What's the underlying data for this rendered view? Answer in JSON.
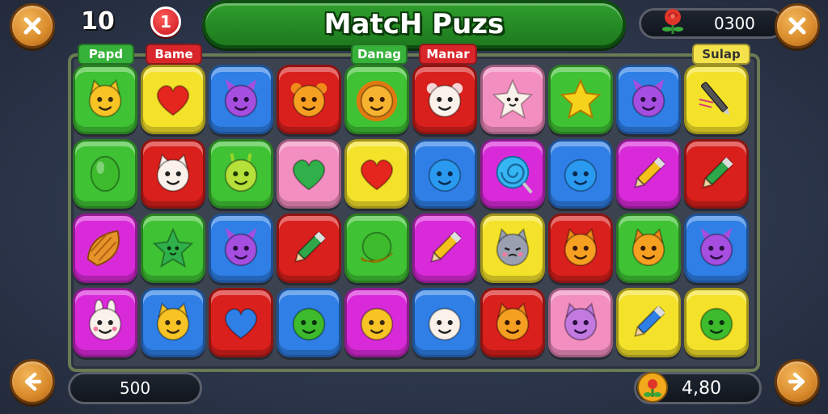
{
  "header": {
    "moves": "10",
    "badge_count": "1",
    "title": "MatcH Puzs",
    "score": "0300"
  },
  "tags": [
    {
      "label": "Papd",
      "color": "green"
    },
    {
      "label": "Bame",
      "color": "red"
    },
    {
      "label": "Danag",
      "color": "green"
    },
    {
      "label": "Manar",
      "color": "red"
    },
    {
      "label": "Sulap",
      "color": "yellow"
    }
  ],
  "footer": {
    "left_value": "500",
    "right_value": "4,80"
  },
  "icons": {
    "top_left": "close-icon",
    "top_right": "close-icon",
    "bottom_left": "arrow-left-icon",
    "bottom_right": "arrow-right-icon",
    "score": "rose-icon",
    "footer_right": "flower-coin-icon"
  },
  "colors": {
    "green": "#3fc234",
    "yellow": "#f4e22a",
    "blue": "#2f7fe6",
    "red": "#d9201c",
    "pink": "#f38ec0",
    "magenta": "#d92ad9",
    "title_green": "#2f9e2c",
    "button_orange": "#d8892a"
  },
  "tiles": [
    [
      {
        "bg": "green",
        "icon": "yellow-cat-face-icon"
      },
      {
        "bg": "yellow",
        "icon": "red-heart-icon"
      },
      {
        "bg": "blue",
        "icon": "purple-monster-face-icon"
      },
      {
        "bg": "red",
        "icon": "orange-bear-face-icon"
      },
      {
        "bg": "green",
        "icon": "orange-lion-face-icon"
      },
      {
        "bg": "red",
        "icon": "white-hamster-face-icon"
      },
      {
        "bg": "pink",
        "icon": "white-star-face-icon"
      },
      {
        "bg": "green",
        "icon": "yellow-star-icon"
      },
      {
        "bg": "blue",
        "icon": "purple-monster-face-icon"
      },
      {
        "bg": "yellow",
        "icon": "pen-icon"
      }
    ],
    [
      {
        "bg": "green",
        "icon": "green-egg-icon"
      },
      {
        "bg": "red",
        "icon": "white-cat-face-icon"
      },
      {
        "bg": "green",
        "icon": "lime-alien-face-icon"
      },
      {
        "bg": "pink",
        "icon": "green-heart-icon"
      },
      {
        "bg": "yellow",
        "icon": "red-heart-icon"
      },
      {
        "bg": "blue",
        "icon": "blue-blob-face-icon"
      },
      {
        "bg": "magenta",
        "icon": "blue-lollipop-icon"
      },
      {
        "bg": "blue",
        "icon": "blue-blob-face-icon"
      },
      {
        "bg": "magenta",
        "icon": "yellow-pencil-icon"
      },
      {
        "bg": "red",
        "icon": "green-marker-icon"
      }
    ],
    [
      {
        "bg": "magenta",
        "icon": "orange-croissant-icon"
      },
      {
        "bg": "green",
        "icon": "green-star-face-icon"
      },
      {
        "bg": "blue",
        "icon": "purple-monster-face-icon"
      },
      {
        "bg": "red",
        "icon": "green-marker-icon"
      },
      {
        "bg": "green",
        "icon": "green-ball-icon"
      },
      {
        "bg": "magenta",
        "icon": "yellow-pencil-icon"
      },
      {
        "bg": "yellow",
        "icon": "grey-cat-face-icon"
      },
      {
        "bg": "red",
        "icon": "orange-fox-face-icon"
      },
      {
        "bg": "green",
        "icon": "orange-fox-face-icon"
      },
      {
        "bg": "blue",
        "icon": "purple-monster-face-icon"
      }
    ],
    [
      {
        "bg": "magenta",
        "icon": "white-bunny-face-icon"
      },
      {
        "bg": "blue",
        "icon": "yellow-cat-face-icon"
      },
      {
        "bg": "red",
        "icon": "blue-heart-icon"
      },
      {
        "bg": "blue",
        "icon": "green-blob-face-icon"
      },
      {
        "bg": "magenta",
        "icon": "yellow-smiley-face-icon"
      },
      {
        "bg": "blue",
        "icon": "white-blob-face-icon"
      },
      {
        "bg": "red",
        "icon": "orange-cat-face-icon"
      },
      {
        "bg": "pink",
        "icon": "purple-cat-face-icon"
      },
      {
        "bg": "yellow",
        "icon": "blue-marker-icon"
      },
      {
        "bg": "yellow",
        "icon": "green-blob-face-icon"
      }
    ]
  ]
}
